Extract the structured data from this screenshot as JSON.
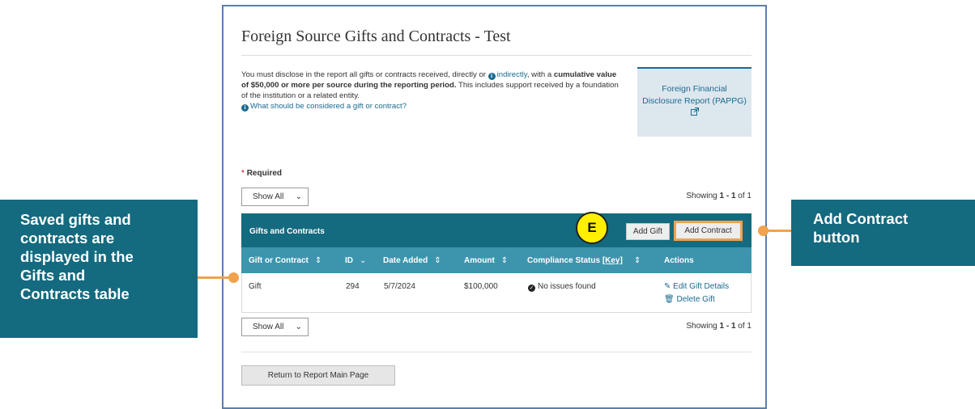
{
  "page": {
    "title": "Foreign Source Gifts and Contracts - Test"
  },
  "intro": {
    "text1": "You must disclose in the report all gifts or contracts received, directly or ",
    "indirectly_link": "indirectly",
    "text2": ", with a ",
    "bold_text": "cumulative value of $50,000 or more per source during the reporting period.",
    "text3": " This includes support received by a foundation of the institution or a related entity.",
    "help_link": "What should be considered a gift or contract?"
  },
  "ffdr": {
    "line1": "Foreign Financial",
    "line2": "Disclosure Report (PAPPG)"
  },
  "required_label": "Required",
  "filter": {
    "selected": "Show All"
  },
  "showing": {
    "prefix": "Showing ",
    "range": "1 - 1",
    "suffix": " of 1"
  },
  "table": {
    "title": "Gifts and Contracts",
    "add_gift_label": "Add Gift",
    "add_contract_label": "Add Contract",
    "columns": {
      "type": "Gift or Contract",
      "id": "ID",
      "date_added": "Date Added",
      "amount": "Amount",
      "compliance": "Compliance Status",
      "compliance_key": "[Key]",
      "actions": "Actions"
    },
    "rows": [
      {
        "type": "Gift",
        "id": "294",
        "date_added": "5/7/2024",
        "amount": "$100,000",
        "compliance": "No issues found",
        "edit_label": "Edit Gift Details",
        "delete_label": "Delete Gift"
      }
    ]
  },
  "marker_letter": "E",
  "return_button_label": "Return to Report Main Page",
  "callouts": {
    "left": {
      "line1": "Saved gifts and",
      "line2": "contracts are",
      "line3": "displayed in the",
      "line4": "Gifts and",
      "line5": "Contracts table"
    },
    "right": {
      "line1": "Add Contract",
      "line2": "button"
    }
  },
  "colors": {
    "header_dark": "#146a7f",
    "header_light": "#3d95ad",
    "link": "#1a6b91",
    "highlight": "#f0a24d",
    "marker": "#ffef00",
    "required_star": "#d0021b"
  },
  "icons": {
    "info": "info-circle-icon",
    "external": "external-link-icon",
    "check": "check-circle-icon",
    "edit": "edit-icon",
    "trash": "trash-icon",
    "sort": "sort-icon",
    "chevron": "chevron-down-icon"
  }
}
